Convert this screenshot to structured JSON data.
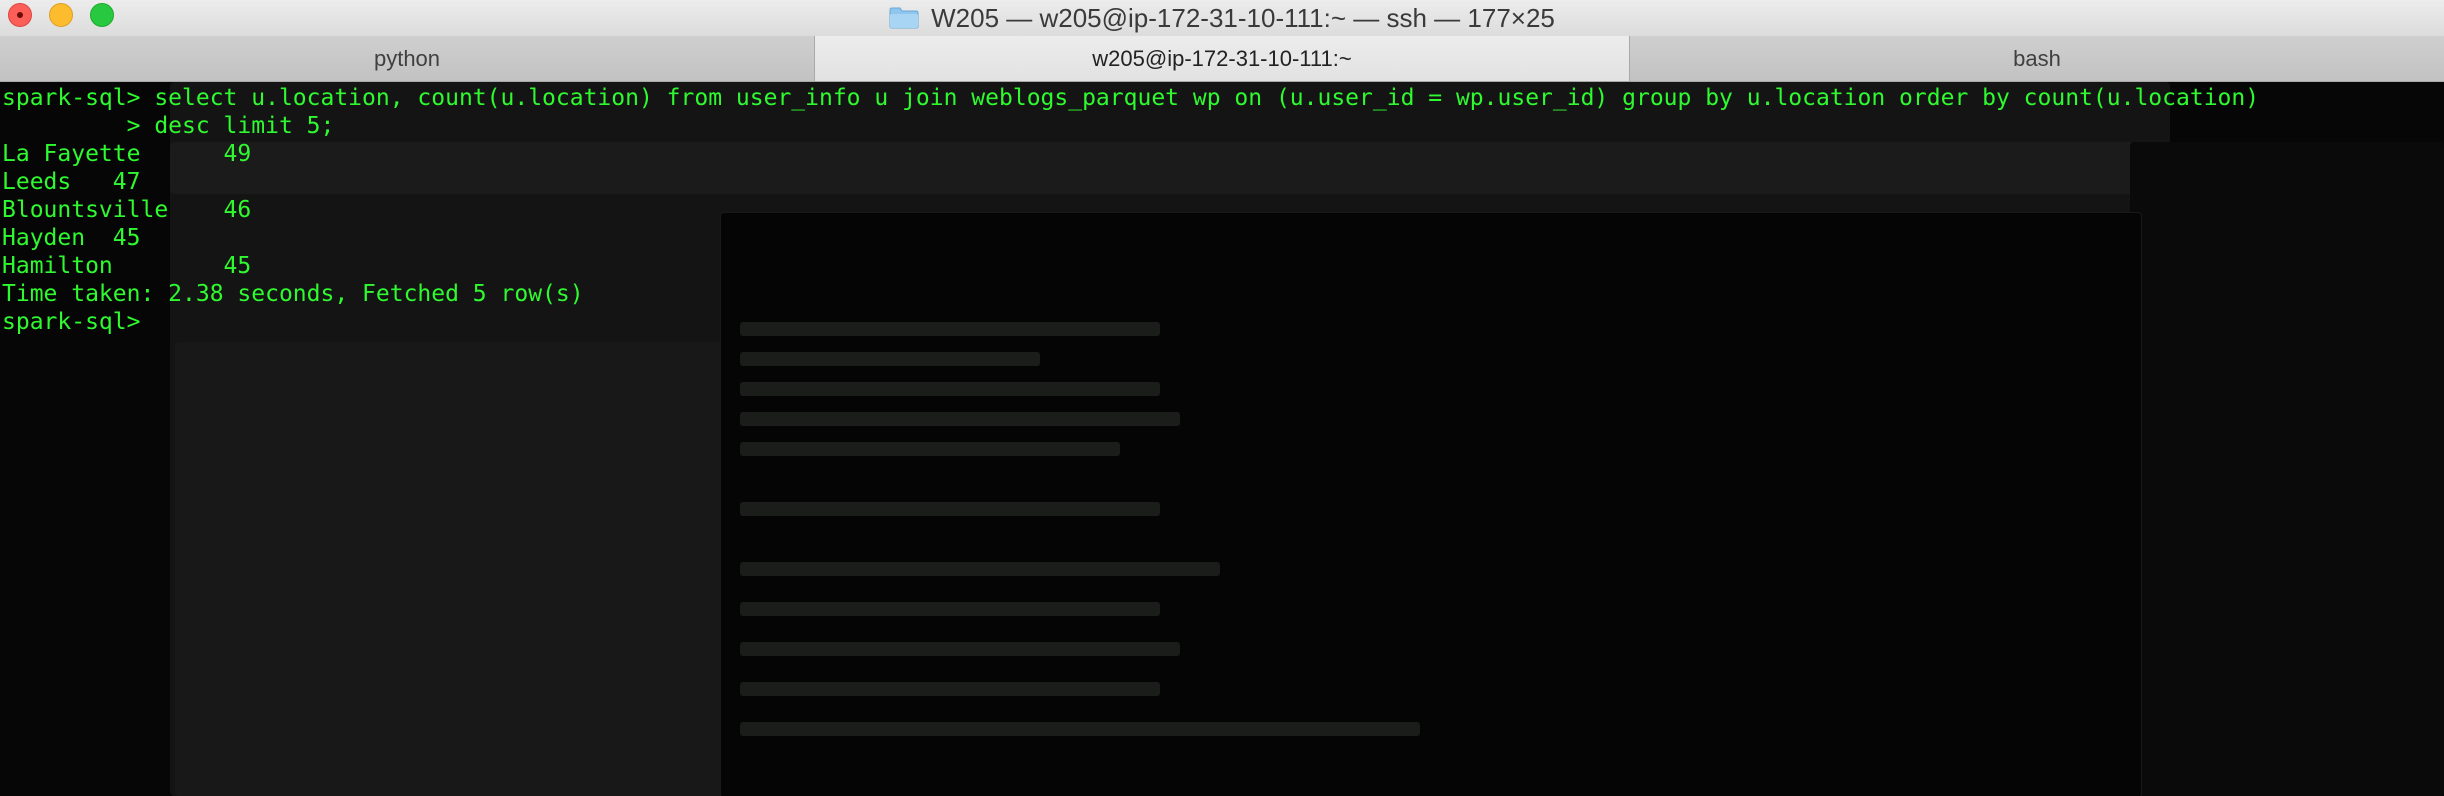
{
  "window": {
    "title": "W205 — w205@ip-172-31-10-111:~ — ssh — 177×25",
    "folder_icon": "folder-icon",
    "traffic_lights": [
      "close",
      "minimize",
      "maximize"
    ]
  },
  "tabs": [
    {
      "label": "python",
      "active": false
    },
    {
      "label": "w205@ip-172-31-10-111:~",
      "active": true
    },
    {
      "label": "bash",
      "active": false
    }
  ],
  "terminal": {
    "text_color": "#2ff92f",
    "background": "#060606",
    "lines": [
      "spark-sql> select u.location, count(u.location) from user_info u join weblogs_parquet wp on (u.user_id = wp.user_id) group by u.location order by count(u.location)",
      "         > desc limit 5;",
      "La Fayette      49",
      "Leeds   47",
      "Blountsville    46",
      "Hayden  45",
      "Hamilton        45",
      "Time taken: 2.38 seconds, Fetched 5 row(s)",
      "spark-sql> "
    ]
  }
}
